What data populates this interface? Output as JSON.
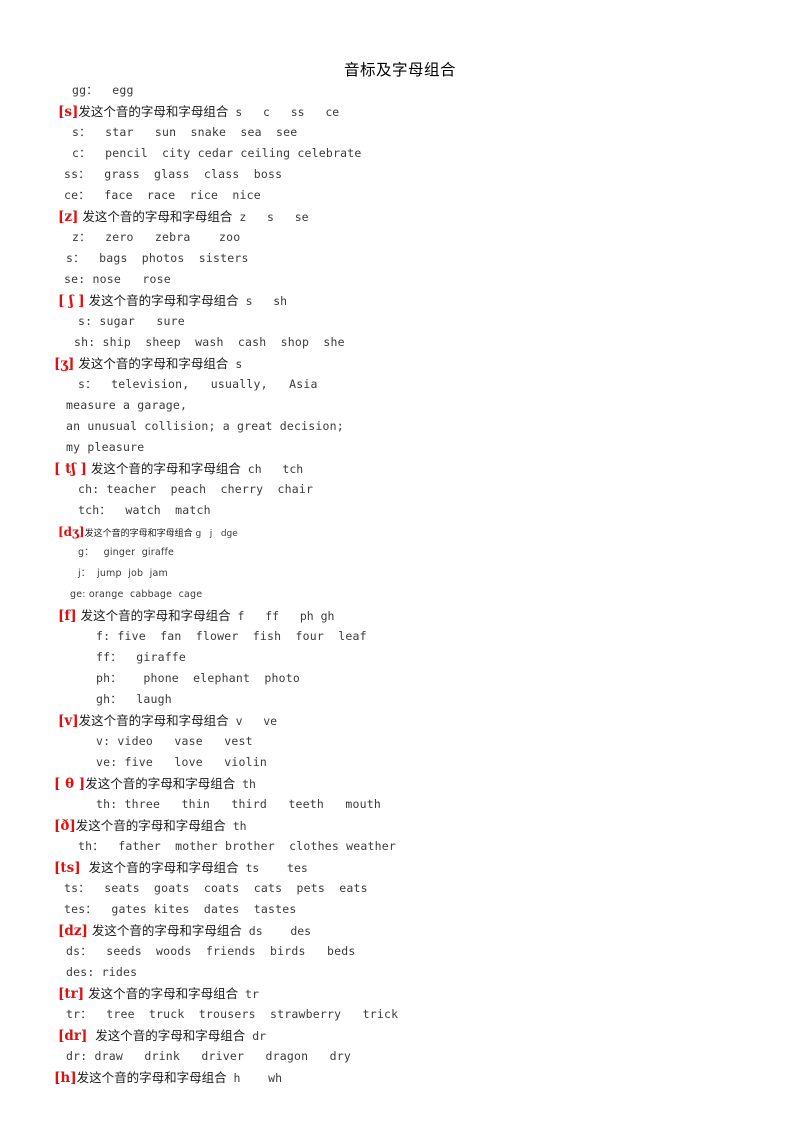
{
  "document": {
    "title": "音标及字母组合",
    "accent_red": "#e01010",
    "text_color": "#2b2b2b",
    "background": "#ffffff"
  },
  "lines": [
    {
      "id": "gg-egg",
      "kind": "example",
      "indent": 72,
      "text": "gg：  egg"
    },
    {
      "id": "s-header",
      "kind": "header",
      "indent": 58,
      "symbol": "[s]",
      "cn": "发这个音的字母和字母组合",
      "latin": " s   c   ss   ce"
    },
    {
      "id": "s-s",
      "kind": "example",
      "indent": 72,
      "text": "s：  star   sun  snake  sea  see"
    },
    {
      "id": "s-c",
      "kind": "example",
      "indent": 72,
      "text": "c：  pencil  city cedar ceiling celebrate"
    },
    {
      "id": "s-ss",
      "kind": "example",
      "indent": 64,
      "text": "ss：  grass  glass  class  boss"
    },
    {
      "id": "s-ce",
      "kind": "example",
      "indent": 64,
      "text": "ce：  face  race  rice  nice"
    },
    {
      "id": "z-header",
      "kind": "header",
      "indent": 58,
      "symbol": "[z]",
      "cn": " 发这个音的字母和字母组合",
      "latin": " z   s   se"
    },
    {
      "id": "z-z",
      "kind": "example",
      "indent": 72,
      "text": "z：  zero   zebra    zoo"
    },
    {
      "id": "z-s",
      "kind": "example",
      "indent": 66,
      "text": "s：  bags  photos  sisters"
    },
    {
      "id": "z-se",
      "kind": "example",
      "indent": 64,
      "text": "se: nose   rose"
    },
    {
      "id": "sh-header",
      "kind": "header",
      "indent": 58,
      "symbol": "[ ʃ ]",
      "cn": " 发这个音的字母和字母组合",
      "latin": " s   sh"
    },
    {
      "id": "sh-s",
      "kind": "example",
      "indent": 78,
      "text": "s: sugar   sure"
    },
    {
      "id": "sh-sh",
      "kind": "example",
      "indent": 74,
      "text": "sh: ship  sheep  wash  cash  shop  she"
    },
    {
      "id": "zh-header",
      "kind": "header",
      "indent": 54,
      "symbol": "[ʒ]",
      "cn": " 发这个音的字母和字母组合",
      "latin": " s"
    },
    {
      "id": "zh-s",
      "kind": "example",
      "indent": 78,
      "text": "s：  television,   usually,   Asia"
    },
    {
      "id": "zh-measure",
      "kind": "example",
      "indent": 66,
      "text": "measure a garage,"
    },
    {
      "id": "zh-unusual",
      "kind": "example",
      "indent": 66,
      "text": "an unusual collision; a great decision;"
    },
    {
      "id": "zh-pleasure",
      "kind": "example",
      "indent": 66,
      "text": "my pleasure"
    },
    {
      "id": "ch-header",
      "kind": "header",
      "indent": 54,
      "symbol": "[ tʃ ]",
      "cn": " 发这个音的字母和字母组合",
      "latin": " ch   tch"
    },
    {
      "id": "ch-ch",
      "kind": "example",
      "indent": 78,
      "text": "ch: teacher  peach  cherry  chair"
    },
    {
      "id": "ch-tch",
      "kind": "example",
      "indent": 78,
      "text": "tch：  watch  match"
    },
    {
      "id": "dzh-header",
      "kind": "header",
      "indent": 58,
      "symbol": "[dʒ]",
      "cn": "发这个音的字母和字母组合",
      "latin": " g   j   dge",
      "small": true
    },
    {
      "id": "dzh-g",
      "kind": "example",
      "indent": 78,
      "text": "g：   ginger  giraffe",
      "small": true
    },
    {
      "id": "dzh-j",
      "kind": "example",
      "indent": 78,
      "text": "j：  jump  job  jam",
      "small": true
    },
    {
      "id": "dzh-ge",
      "kind": "example",
      "indent": 70,
      "text": "ge: orange  cabbage  cage",
      "small": true
    },
    {
      "id": "f-header",
      "kind": "header",
      "indent": 58,
      "symbol": "[f]",
      "cn": " 发这个音的字母和字母组合",
      "latin": " f   ff   ph gh"
    },
    {
      "id": "f-f",
      "kind": "example",
      "indent": 96,
      "text": "f: five  fan  flower  fish  four  leaf"
    },
    {
      "id": "f-ff",
      "kind": "example",
      "indent": 96,
      "text": "ff：  giraffe"
    },
    {
      "id": "f-ph",
      "kind": "example",
      "indent": 96,
      "text": "ph：   phone  elephant  photo"
    },
    {
      "id": "f-gh",
      "kind": "example",
      "indent": 96,
      "text": "gh：  laugh"
    },
    {
      "id": "v-header",
      "kind": "header",
      "indent": 58,
      "symbol": "[v]",
      "cn": "发这个音的字母和字母组合",
      "latin": " v   ve"
    },
    {
      "id": "v-v",
      "kind": "example",
      "indent": 96,
      "text": "v: video   vase   vest"
    },
    {
      "id": "v-ve",
      "kind": "example",
      "indent": 96,
      "text": "ve: five   love   violin"
    },
    {
      "id": "th-header",
      "kind": "header",
      "indent": 54,
      "symbol": "[ θ ]",
      "cn": "发这个音的字母和字母组合",
      "latin": " th"
    },
    {
      "id": "th-th",
      "kind": "example",
      "indent": 96,
      "text": "th: three   thin   third   teeth   mouth"
    },
    {
      "id": "dh-header",
      "kind": "header",
      "indent": 54,
      "symbol": "[ð]",
      "cn": "发这个音的字母和字母组合",
      "latin": " th"
    },
    {
      "id": "dh-th",
      "kind": "example",
      "indent": 78,
      "text": "th：  father  mother brother  clothes weather"
    },
    {
      "id": "ts-header",
      "kind": "header",
      "indent": 54,
      "symbol": "[ts]",
      "cn": "  发这个音的字母和字母组合",
      "latin": " ts    tes"
    },
    {
      "id": "ts-ts",
      "kind": "example",
      "indent": 64,
      "text": "ts：  seats  goats  coats  cats  pets  eats"
    },
    {
      "id": "ts-tes",
      "kind": "example",
      "indent": 64,
      "text": "tes：  gates kites  dates  tastes"
    },
    {
      "id": "dz-header",
      "kind": "header",
      "indent": 58,
      "symbol": "[dz]",
      "cn": " 发这个音的字母和字母组合",
      "latin": " ds    des"
    },
    {
      "id": "dz-ds",
      "kind": "example",
      "indent": 66,
      "text": "ds：  seeds  woods  friends  birds   beds"
    },
    {
      "id": "dz-des",
      "kind": "example",
      "indent": 66,
      "text": "des: rides"
    },
    {
      "id": "tr-header",
      "kind": "header",
      "indent": 58,
      "symbol": "[tr]",
      "cn": " 发这个音的字母和字母组合",
      "latin": " tr"
    },
    {
      "id": "tr-tr",
      "kind": "example",
      "indent": 66,
      "text": "tr：  tree  truck  trousers  strawberry   trick"
    },
    {
      "id": "dr-header",
      "kind": "header",
      "indent": 58,
      "symbol": "[dr]",
      "cn": "  发这个音的字母和字母组合",
      "latin": " dr"
    },
    {
      "id": "dr-dr",
      "kind": "example",
      "indent": 66,
      "text": "dr: draw   drink   driver   dragon   dry"
    },
    {
      "id": "h-header",
      "kind": "header",
      "indent": 54,
      "symbol": "[h]",
      "cn": "发这个音的字母和字母组合",
      "latin": " h    wh"
    }
  ]
}
